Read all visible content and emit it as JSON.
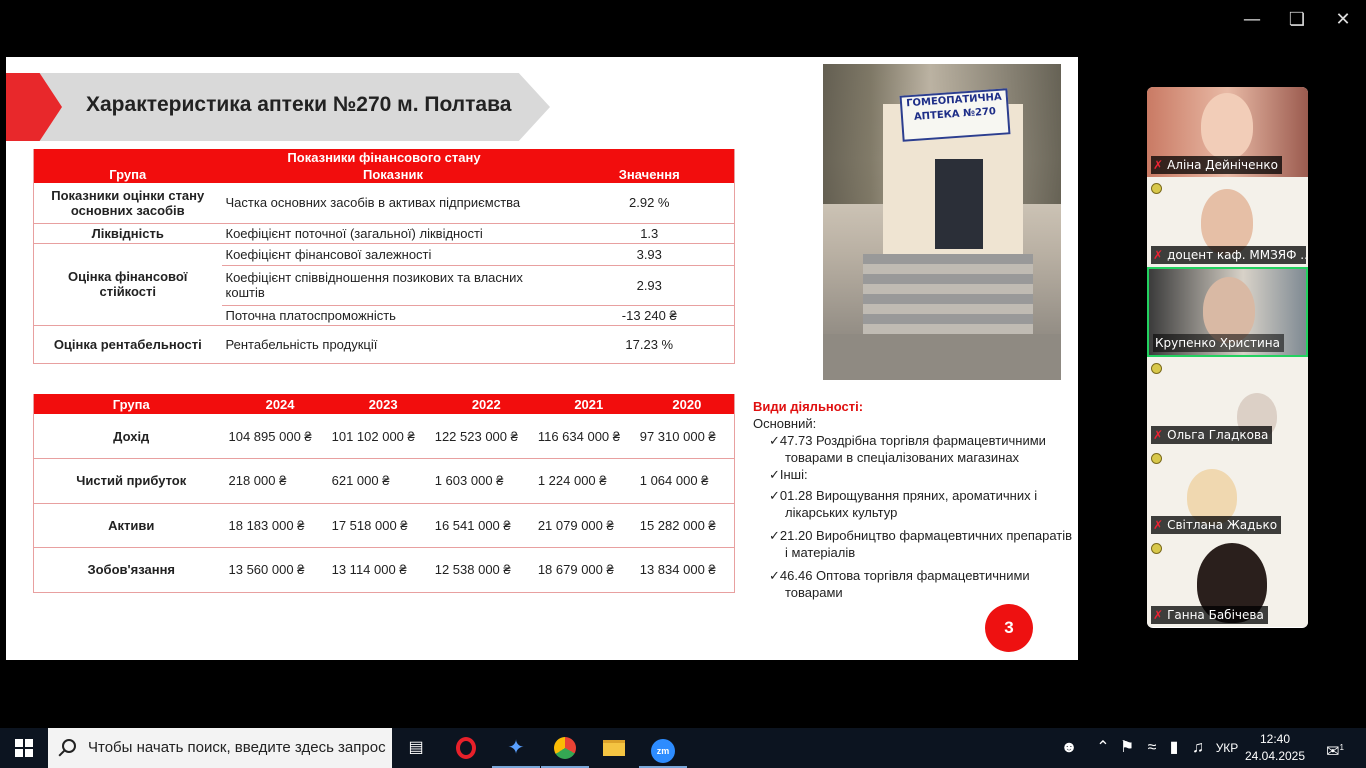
{
  "window": {
    "minimize_icon": "minimize-icon",
    "restore_icon": "restore-icon",
    "close_icon": "close-icon"
  },
  "slide": {
    "title": "Характеристика аптеки №270 м. Полтава",
    "fin_table": {
      "caption": "Показники фінансового стану",
      "headers": [
        "Група",
        "Показник",
        "Значення"
      ],
      "rows": [
        {
          "group": "Показники оцінки стану основних засобів",
          "indicator": "Частка основних засобів в активах підприємства",
          "value": "2.92 %"
        },
        {
          "group": "Ліквідність",
          "indicator": "Коефіцієнт поточної (загальної) ліквідності",
          "value": "1.3"
        },
        {
          "group": "Оцінка фінансової стійкості",
          "indicator": "Коефіцієнт фінансової залежності",
          "value": "3.93"
        },
        {
          "group": "",
          "indicator": "Коефіцієнт співвідношення позикових та власних коштів",
          "value": "2.93"
        },
        {
          "group": "",
          "indicator": "Поточна платоспроможність",
          "value": "-13 240 ₴"
        },
        {
          "group": "Оцінка рентабельності",
          "indicator": "Рентабельність продукції",
          "value": "17.23 %"
        }
      ]
    },
    "year_table": {
      "headers": [
        "Група",
        "2024",
        "2023",
        "2022",
        "2021",
        "2020"
      ],
      "rows": [
        {
          "group": "Дохід",
          "v": [
            "104 895 000 ₴",
            "101 102 000 ₴",
            "122 523 000 ₴",
            "116 634 000 ₴",
            "97 310 000 ₴"
          ]
        },
        {
          "group": "Чистий прибуток",
          "v": [
            "218 000 ₴",
            "621 000 ₴",
            "1 603 000 ₴",
            "1 224 000 ₴",
            "1 064 000 ₴"
          ]
        },
        {
          "group": "Активи",
          "v": [
            "18 183 000 ₴",
            "17 518 000 ₴",
            "16 541 000 ₴",
            "21 079 000 ₴",
            "15 282 000 ₴"
          ]
        },
        {
          "group": "Зобов'язання",
          "v": [
            "13 560 000 ₴",
            "13 114 000 ₴",
            "12 538 000 ₴",
            "18 679 000 ₴",
            "13 834 000 ₴"
          ]
        }
      ]
    },
    "photo": {
      "sign_line1": "ГОМЕОПАТИЧНА",
      "sign_line2": "АПТЕКА №270"
    },
    "activities": {
      "heading": "Види діяльності:",
      "main_label": "Основний:",
      "main_item": "✓47.73 Роздрібна торгівля фармацевтичними товарами в спеціалізованих магазинах",
      "other_label": "✓Інші:",
      "others": [
        "✓01.28 Вирощування пряних, ароматичних і лікарських культур",
        "✓21.20 Виробництво фармацевтичних препаратів і матеріалів",
        "✓46.46 Оптова торгівля фармацевтичними товарами"
      ]
    },
    "page_number": "3"
  },
  "participants": [
    {
      "name": "Аліна Дейніченко"
    },
    {
      "name": "доцент каф. ММЗЯФ ..."
    },
    {
      "name": "Крупенко Христина"
    },
    {
      "name": "Ольга Гладкова"
    },
    {
      "name": "Світлана Жадько"
    },
    {
      "name": "Ганна Бабічева"
    }
  ],
  "taskbar": {
    "search_placeholder": "Чтобы начать поиск, введите здесь запрос",
    "lang": "УКР",
    "time": "12:40",
    "date": "24.04.2025",
    "notifications": "1"
  }
}
